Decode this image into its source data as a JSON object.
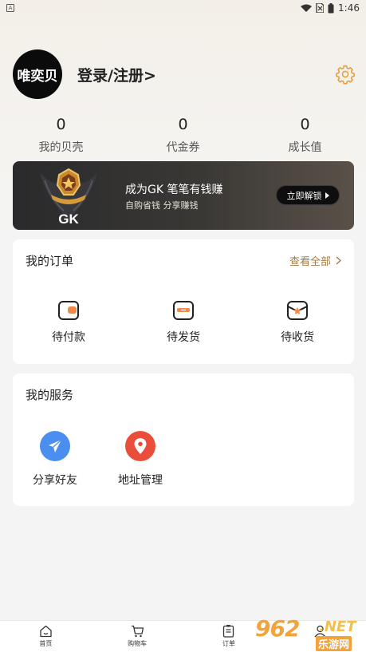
{
  "status_bar": {
    "time": "1:46",
    "app_icon": "A"
  },
  "profile": {
    "avatar_text": "唯奕贝",
    "login_label": "登录/注册>"
  },
  "stats": [
    {
      "value": "0",
      "label": "我的贝壳"
    },
    {
      "value": "0",
      "label": "代金券"
    },
    {
      "value": "0",
      "label": "成长值"
    }
  ],
  "vip_banner": {
    "badge_text": "GK",
    "title": "成为GK 笔笔有钱赚",
    "subtitle": "自购省钱 分享赚钱",
    "button_label": "立即解锁"
  },
  "orders": {
    "title": "我的订单",
    "view_all": "查看全部",
    "items": [
      {
        "label": "待付款",
        "icon": "wallet-icon"
      },
      {
        "label": "待发货",
        "icon": "box-icon"
      },
      {
        "label": "待收货",
        "icon": "delivery-icon"
      }
    ]
  },
  "services": {
    "title": "我的服务",
    "items": [
      {
        "label": "分享好友",
        "icon": "paper-plane-icon",
        "color": "#4a8ef0"
      },
      {
        "label": "地址管理",
        "icon": "location-pin-icon",
        "color": "#ea4d3a"
      }
    ]
  },
  "tab_bar": {
    "items": [
      {
        "label": "首页",
        "icon": "home-icon"
      },
      {
        "label": "购物车",
        "icon": "cart-icon"
      },
      {
        "label": "订单",
        "icon": "order-list-icon"
      },
      {
        "label": "",
        "icon": "user-icon"
      }
    ]
  },
  "watermark": {
    "number": "962",
    "suffix": ".NET",
    "name": "乐游网"
  },
  "colors": {
    "accent": "#e4a340",
    "link": "#a27c45",
    "banner_dark": "#2a2a2c"
  }
}
